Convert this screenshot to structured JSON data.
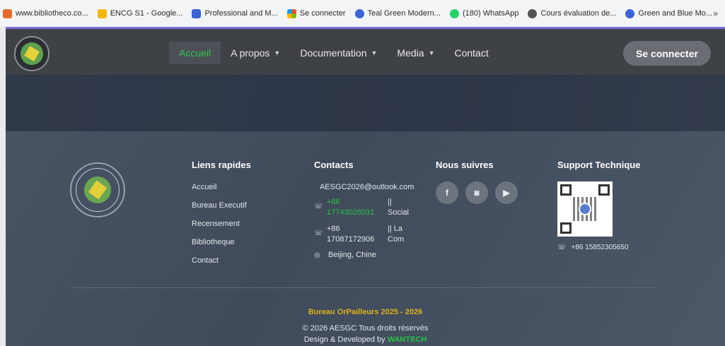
{
  "bookmarks": [
    {
      "label": "www.bibliotheco.co...",
      "icon": "site-favicon",
      "color": "#e86b2b"
    },
    {
      "label": "ENCG S1 - Google...",
      "icon": "google-drive-icon",
      "color": "#f2b705"
    },
    {
      "label": "Professional and M...",
      "icon": "canva-icon",
      "color": "#3b63d8"
    },
    {
      "label": "Se connecter",
      "icon": "microsoft-icon",
      "color": "#f25022"
    },
    {
      "label": "Teal Green Modern...",
      "icon": "canva-icon",
      "color": "#3b63d8"
    },
    {
      "label": "(180) WhatsApp",
      "icon": "whatsapp-icon",
      "color": "#25d366"
    },
    {
      "label": "Cours évaluation de...",
      "icon": "gear-icon",
      "color": "#555555"
    },
    {
      "label": "Green and Blue Mo...",
      "icon": "canva-icon",
      "color": "#3b63d8"
    }
  ],
  "bookmarks_more": "»",
  "nav": {
    "items": [
      {
        "label": "Accueil",
        "active": true,
        "dropdown": false
      },
      {
        "label": "A propos",
        "active": false,
        "dropdown": true
      },
      {
        "label": "Documentation",
        "active": false,
        "dropdown": true
      },
      {
        "label": "Media",
        "active": false,
        "dropdown": true
      },
      {
        "label": "Contact",
        "active": false,
        "dropdown": false
      }
    ],
    "login": "Se connecter"
  },
  "footer": {
    "quick_links_title": "Liens rapides",
    "quick_links": [
      "Accueil",
      "Bureau Executif",
      "Recensement",
      "Bibliotheque",
      "Contact"
    ],
    "contacts_title": "Contacts",
    "email": "AESGC2026@outlook.com",
    "phones": [
      {
        "num1": "+86",
        "num2": "17743028031",
        "lbl1": "||",
        "lbl2": "Social",
        "green": true
      },
      {
        "num1": "+86",
        "num2": "17087172906",
        "lbl1": "|| La",
        "lbl2": "Com",
        "green": false
      }
    ],
    "location": "Beijing, Chine",
    "follow_title": "Nous suivres",
    "socials": [
      "facebook-icon",
      "instagram-icon",
      "youtube-icon"
    ],
    "support_title": "Support Technique",
    "support_phone": "+86 15852305650",
    "bottom_title": "Bureau OrPailleurs 2025 - 2026",
    "copyright": "© 2026 AESGC Tous droits réservés",
    "designed_prefix": "Design & Developed by ",
    "designed_brand": "WANTECH"
  },
  "colors": {
    "accent_green": "#29c24a",
    "gold": "#e0b11d"
  }
}
